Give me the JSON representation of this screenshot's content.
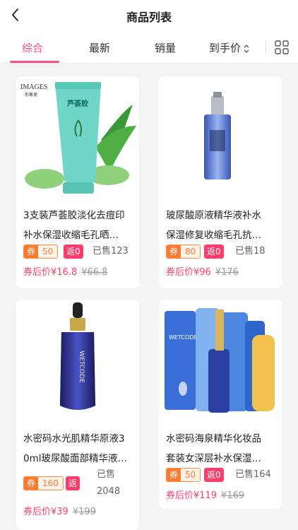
{
  "header": {
    "title": "商品列表"
  },
  "sort_tabs": [
    {
      "label": "综合",
      "active": true
    },
    {
      "label": "最新"
    },
    {
      "label": "销量"
    },
    {
      "label": "到手价"
    }
  ],
  "products": [
    {
      "title_line1": "3支装芦荟胶淡化去痘印",
      "title_line2": "补水保湿收缩毛孔晒…",
      "coupon_tag": "券",
      "coupon_value": "50",
      "rebate_tag": "返0",
      "sold": "已售123",
      "price_label": "券后价",
      "price": "¥16.8",
      "original_price": "¥66.8",
      "image_text_brand": "IMAGES",
      "image_text_brand_cn": "形象美",
      "image_text_product": "芦荟胶"
    },
    {
      "title_line1": "玻尿酸原液精华液补水",
      "title_line2": "保湿修复收缩毛孔抗…",
      "coupon_tag": "券",
      "coupon_value": "80",
      "rebate_tag": "返0",
      "sold": "已售18",
      "price_label": "券后价",
      "price": "¥96",
      "original_price": "¥176"
    },
    {
      "title_line1": "水密码水光肌精华原液3",
      "title_line2": "0ml玻尿酸面部精华液…",
      "coupon_tag": "券",
      "coupon_value": "160",
      "rebate_tag": "返",
      "sold_line1": "已售",
      "sold_line2": "2048",
      "price_label": "券后价",
      "price": "¥39",
      "original_price": "¥199",
      "image_text_brand": "WETCODE"
    },
    {
      "title_line1": "水密码海泉精华化妆品",
      "title_line2": "套装女深层补水保湿…",
      "coupon_tag": "券",
      "coupon_value": "50",
      "rebate_tag": "返0",
      "sold": "已售164",
      "price_label": "券后价",
      "price": "¥119",
      "original_price": "¥169",
      "image_text_brand": "WETCODE"
    }
  ],
  "colors": {
    "accent": "#ff4f8a",
    "coupon": "#ff7a2f",
    "rebate": "#ff3d6c"
  }
}
